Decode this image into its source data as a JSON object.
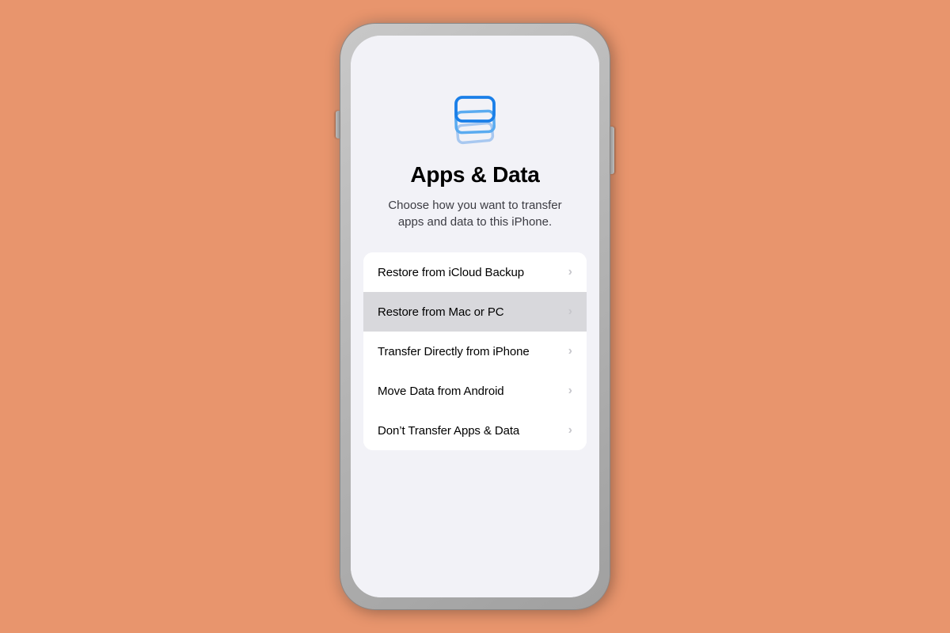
{
  "background_color": "#E8956D",
  "page": {
    "title": "Apps & Data",
    "subtitle": "Choose how you want to transfer apps and data to this iPhone.",
    "icon_label": "apps-and-data-icon"
  },
  "menu": {
    "items": [
      {
        "id": "restore-icloud",
        "label": "Restore from iCloud Backup",
        "highlighted": false
      },
      {
        "id": "restore-mac-pc",
        "label": "Restore from Mac or PC",
        "highlighted": true
      },
      {
        "id": "transfer-iphone",
        "label": "Transfer Directly from iPhone",
        "highlighted": false
      },
      {
        "id": "move-android",
        "label": "Move Data from Android",
        "highlighted": false
      },
      {
        "id": "no-transfer",
        "label": "Don’t Transfer Apps & Data",
        "highlighted": false
      }
    ]
  }
}
